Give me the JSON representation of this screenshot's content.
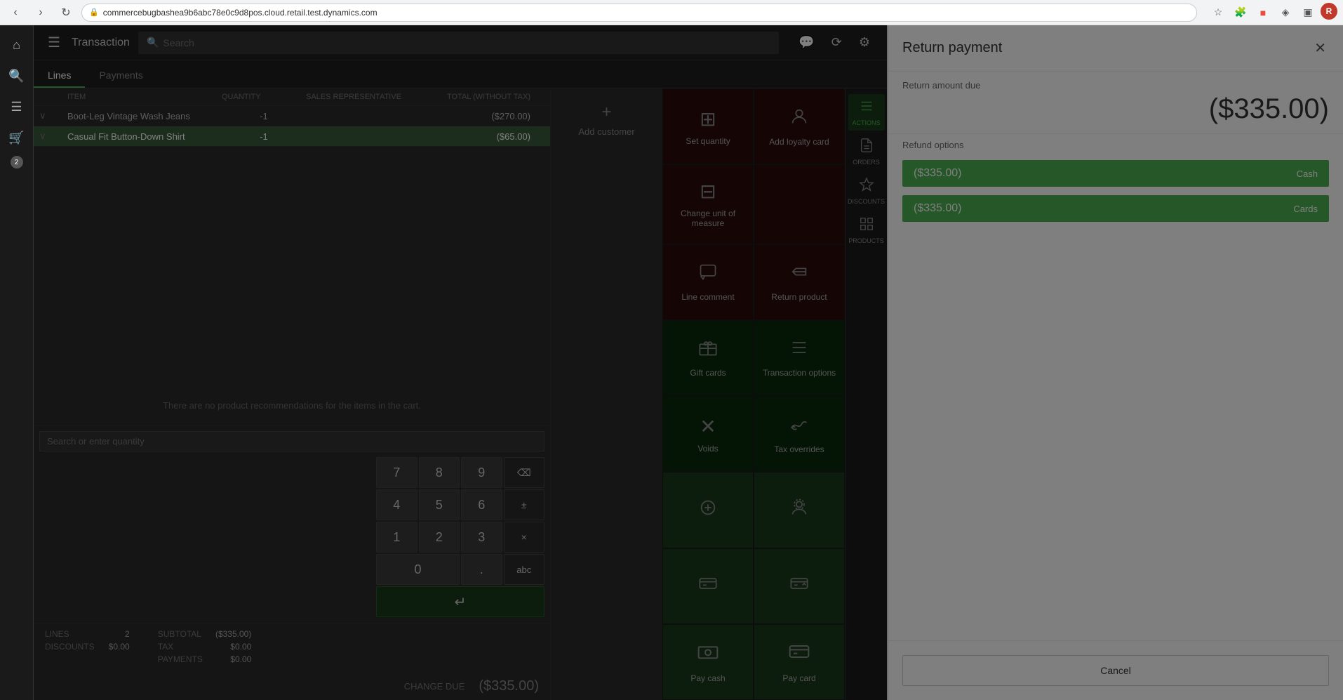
{
  "browser": {
    "url": "commercebugbashea9b6abc78e0c9d8pos.cloud.retail.test.dynamics.com",
    "nav": {
      "back": "‹",
      "forward": "›",
      "refresh": "↺"
    }
  },
  "topbar": {
    "title": "Transaction",
    "search_placeholder": "Search"
  },
  "tabs": [
    {
      "label": "Lines",
      "active": true
    },
    {
      "label": "Payments",
      "active": false
    }
  ],
  "table": {
    "headers": [
      "",
      "ITEM",
      "QUANTITY",
      "SALES REPRESENTATIVE",
      "TOTAL (WITHOUT TAX)"
    ],
    "rows": [
      {
        "arrow": "∨",
        "name": "Boot-Leg Vintage Wash Jeans",
        "quantity": "-1",
        "rep": "",
        "total": "($270.00)",
        "selected": false
      },
      {
        "arrow": "∨",
        "name": "Casual Fit Button-Down Shirt",
        "quantity": "-1",
        "rep": "",
        "total": "($65.00)",
        "selected": true
      }
    ]
  },
  "recommendations_text": "There are no product recommendations for the items in the cart.",
  "customer": {
    "add_label": "Add customer"
  },
  "numpad": {
    "search_placeholder": "Search or enter quantity",
    "keys": [
      "7",
      "8",
      "9",
      "⌫",
      "4",
      "5",
      "6",
      "±",
      "1",
      "2",
      "3",
      "×",
      "0",
      ".",
      "abc"
    ],
    "enter_symbol": "↵"
  },
  "summary": {
    "lines_label": "LINES",
    "lines_value": "2",
    "discounts_label": "DISCOUNTS",
    "discounts_value": "$0.00",
    "subtotal_label": "SUBTOTAL",
    "subtotal_value": "($335.00)",
    "tax_label": "TAX",
    "tax_value": "$0.00",
    "payments_label": "PAYMENTS",
    "payments_value": "$0.00",
    "change_due_label": "CHANGE DUE",
    "change_due_value": "($335.00)"
  },
  "action_tiles": [
    {
      "id": "set-quantity",
      "label": "Set quantity",
      "icon": "⊞",
      "style": "dark-red"
    },
    {
      "id": "add-loyalty",
      "label": "Add loyalty card",
      "icon": "👤",
      "style": "dark-red"
    },
    {
      "id": "change-unit",
      "label": "Change unit of measure",
      "icon": "⊟",
      "style": "dark-red"
    },
    {
      "id": "blank1",
      "label": "",
      "icon": "",
      "style": "dark-red"
    },
    {
      "id": "line-comment",
      "label": "Line comment",
      "icon": "💬",
      "style": "dark-red"
    },
    {
      "id": "return-product",
      "label": "Return product",
      "icon": "📦",
      "style": "dark-red"
    },
    {
      "id": "gift-cards",
      "label": "Gift cards",
      "icon": "🎴",
      "style": "dark-green"
    },
    {
      "id": "transaction-options",
      "label": "Transaction options",
      "icon": "☰",
      "style": "dark-green"
    },
    {
      "id": "voids",
      "label": "Voids",
      "icon": "✕",
      "style": "dark-green"
    },
    {
      "id": "tax-overrides",
      "label": "Tax overrides",
      "icon": "↩",
      "style": "dark-green"
    },
    {
      "id": "btn-a",
      "label": "",
      "icon": "⊙",
      "style": "medium-green"
    },
    {
      "id": "btn-b",
      "label": "",
      "icon": "👤",
      "style": "medium-green"
    },
    {
      "id": "btn-c",
      "label": "",
      "icon": "💳",
      "style": "medium-green"
    },
    {
      "id": "btn-d",
      "label": "",
      "icon": "💳",
      "style": "medium-green"
    },
    {
      "id": "pay-cash",
      "label": "Pay cash",
      "icon": "💵",
      "style": "medium-green"
    },
    {
      "id": "pay-card",
      "label": "Pay card",
      "icon": "💳",
      "style": "medium-green"
    }
  ],
  "side_strip": [
    {
      "id": "actions",
      "icon": "≡",
      "label": "ACTIONS",
      "active": true
    },
    {
      "id": "orders",
      "icon": "📋",
      "label": "ORDERS",
      "active": false
    },
    {
      "id": "discounts",
      "icon": "◇",
      "label": "DISCOUNTS",
      "active": false
    },
    {
      "id": "products",
      "icon": "⊞",
      "label": "PRODUCTS",
      "active": false
    }
  ],
  "return_panel": {
    "title": "Return payment",
    "close_symbol": "✕",
    "amount_due_label": "Return amount due",
    "amount_due_value": "($335.00)",
    "refund_options_label": "Refund options",
    "options": [
      {
        "amount": "($335.00)",
        "type": "Cash"
      },
      {
        "amount": "($335.00)",
        "type": "Cards"
      }
    ],
    "cancel_label": "Cancel"
  }
}
